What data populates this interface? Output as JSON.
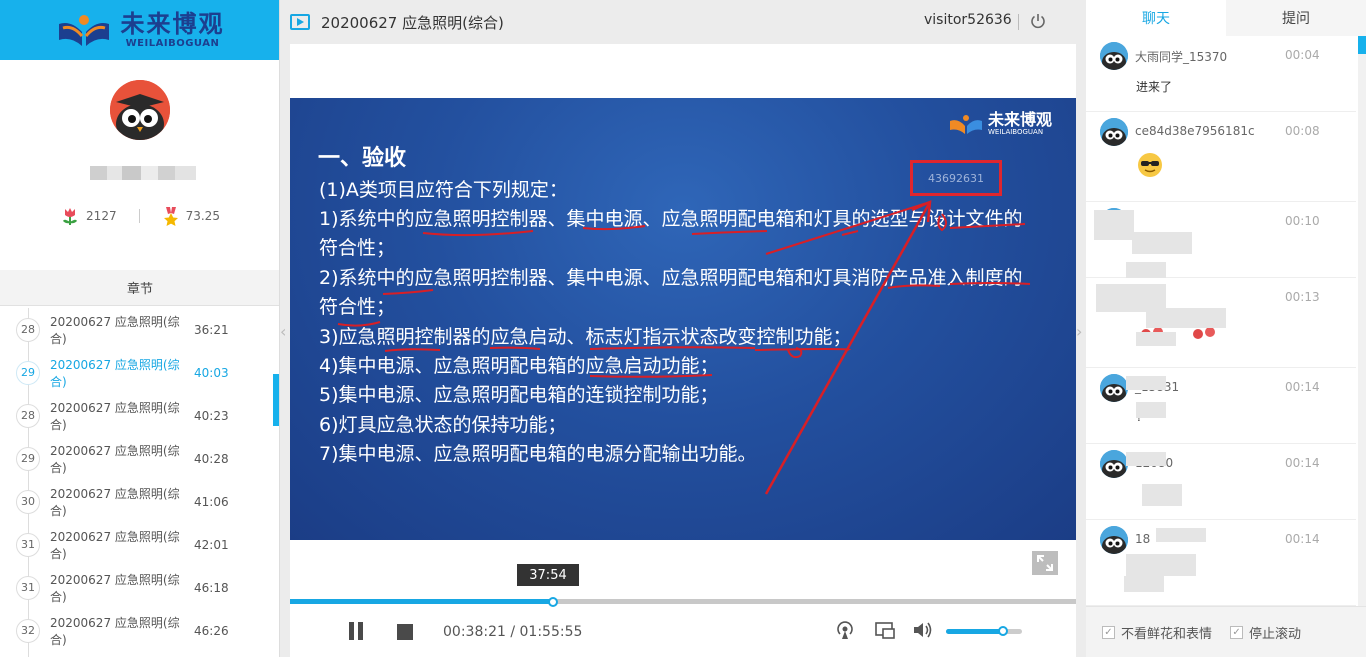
{
  "brand": {
    "name_cn": "未来博观",
    "name_en": "WEILAIBOGUAN"
  },
  "profile": {
    "stats": [
      {
        "icon": "flower-icon",
        "value": "2127"
      },
      {
        "icon": "medal-icon",
        "value": "73.25"
      }
    ]
  },
  "chapters": {
    "header": "章节",
    "items": [
      {
        "num": "28",
        "title": "20200627 应急照明(综合)",
        "time": "36:21",
        "active": false
      },
      {
        "num": "29",
        "title": "20200627 应急照明(综合)",
        "time": "40:03",
        "active": true
      },
      {
        "num": "28",
        "title": "20200627 应急照明(综合)",
        "time": "40:23",
        "active": false
      },
      {
        "num": "29",
        "title": "20200627 应急照明(综合)",
        "time": "40:28",
        "active": false
      },
      {
        "num": "30",
        "title": "20200627 应急照明(综合)",
        "time": "41:06",
        "active": false
      },
      {
        "num": "31",
        "title": "20200627 应急照明(综合)",
        "time": "42:01",
        "active": false
      },
      {
        "num": "31",
        "title": "20200627 应急照明(综合)",
        "time": "46:18",
        "active": false
      },
      {
        "num": "32",
        "title": "20200627 应急照明(综合)",
        "time": "46:26",
        "active": false
      }
    ]
  },
  "header": {
    "title": "20200627 应急照明(综合)",
    "user": "visitor52636"
  },
  "slide": {
    "logo_cn": "未来博观",
    "logo_en": "WEILAIBOGUAN",
    "heading": "一、验收",
    "code": "43692631",
    "lines": [
      "(1)A类项目应符合下列规定：",
      "1)系统中的应急照明控制器、集中电源、应急照明配电箱和灯具的选型与设计文件的",
      "符合性；",
      "2)系统中的应急照明控制器、集中电源、应急照明配电箱和灯具消防产品准入制度的",
      "符合性；",
      "3)应急照明控制器的应急启动、标志灯指示状态改变控制功能；",
      "4)集中电源、应急照明配电箱的应急启动功能；",
      "5)集中电源、应急照明配电箱的连锁控制功能；",
      "6)灯具应急状态的保持功能；",
      "7)集中电源、应急照明配电箱的电源分配输出功能。"
    ]
  },
  "player": {
    "hover_time": "37:54",
    "current_time": "00:38:21",
    "total_time": "01:55:55",
    "progress": 0.335,
    "hover_progress": 0.33,
    "volume": 0.75,
    "accent": "#17a7e3"
  },
  "sidepanel": {
    "tabs": [
      {
        "label": "聊天",
        "active": true
      },
      {
        "label": "提问",
        "active": false
      }
    ],
    "messages": [
      {
        "user": "大雨同学_15370",
        "time": "00:04",
        "text": "进来了"
      },
      {
        "user": "ce84d38e7956181c",
        "time": "00:08",
        "text": ""
      },
      {
        "user": "",
        "time": "00:10",
        "text": ""
      },
      {
        "user": "",
        "time": "00:13",
        "text": ""
      },
      {
        "user": "_15831",
        "time": "00:14",
        "text": "?"
      },
      {
        "user": "12080",
        "time": "00:14",
        "text": ""
      },
      {
        "user": "18",
        "time": "00:14",
        "text": ""
      }
    ],
    "options": [
      {
        "label": "不看鲜花和表情",
        "checked": true
      },
      {
        "label": "停止滚动",
        "checked": true
      }
    ]
  }
}
